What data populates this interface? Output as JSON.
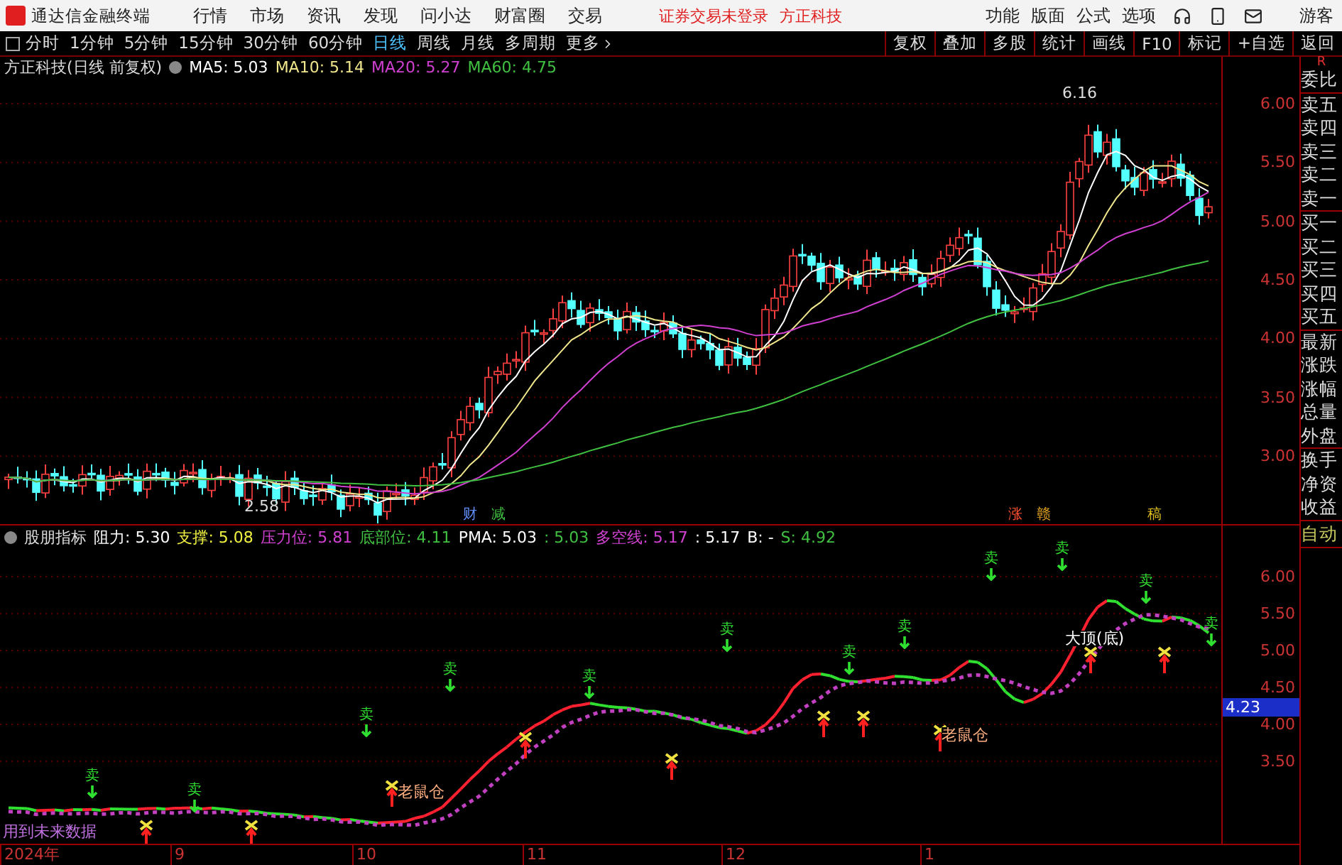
{
  "app_bar": {
    "title": "通达信金融终端",
    "menu": [
      "行情",
      "市场",
      "资讯",
      "发现",
      "问小达",
      "财富圈",
      "交易"
    ],
    "notice": "证券交易未登录",
    "stock": "方正科技",
    "right_menu": [
      "功能",
      "版面",
      "公式",
      "选项"
    ],
    "user": "游客"
  },
  "period_tabs": [
    {
      "label": "分时",
      "selected": false
    },
    {
      "label": "1分钟",
      "selected": false
    },
    {
      "label": "5分钟",
      "selected": false
    },
    {
      "label": "15分钟",
      "selected": false
    },
    {
      "label": "30分钟",
      "selected": false
    },
    {
      "label": "60分钟",
      "selected": false
    },
    {
      "label": "日线",
      "selected": true
    },
    {
      "label": "周线",
      "selected": false
    },
    {
      "label": "月线",
      "selected": false
    },
    {
      "label": "多周期",
      "selected": false
    },
    {
      "label": "更多",
      "selected": false
    }
  ],
  "tools": [
    "复权",
    "叠加",
    "多股",
    "统计",
    "画线",
    "F10",
    "标记",
    "+自选",
    "返回"
  ],
  "main_chart": {
    "title": "方正科技(日线 前复权)",
    "ma": [
      {
        "label": "MA5: 5.03",
        "color": "#ffffff"
      },
      {
        "label": "MA10: 5.14",
        "color": "#f0e68c"
      },
      {
        "label": "MA20: 5.27",
        "color": "#d040d0"
      },
      {
        "label": "MA60: 4.75",
        "color": "#40c040"
      }
    ],
    "high_label": "6.16",
    "low_label": "2.58",
    "events": [
      {
        "text": "财",
        "color": "#6090ff"
      },
      {
        "text": "减",
        "color": "#40c040"
      },
      {
        "text": "涨",
        "color": "#ff5030"
      },
      {
        "text": "赣",
        "color": "#e0a020"
      },
      {
        "text": "稿",
        "color": "#e0c020"
      }
    ],
    "y_axis": [
      "6.00",
      "5.50",
      "5.00",
      "4.50",
      "4.00",
      "3.50",
      "3.00"
    ]
  },
  "indicator": {
    "name": "股朋指标",
    "values": [
      {
        "text": "阻力: 5.30",
        "color": "#ffffff"
      },
      {
        "text": "支撑: 5.08",
        "color": "#f0f040"
      },
      {
        "text": "压力位: 5.81",
        "color": "#d040d0"
      },
      {
        "text": "底部位: 4.11",
        "color": "#40c040"
      },
      {
        "text": "PMA: 5.03",
        "color": "#ffffff"
      },
      {
        "text": ": 5.03",
        "color": "#40c040"
      },
      {
        "text": "多空线: 5.17",
        "color": "#d040d0"
      },
      {
        "text": ": 5.17",
        "color": "#ffffff"
      },
      {
        "text": "B: -",
        "color": "#ffffff"
      },
      {
        "text": "S: 4.92",
        "color": "#40c040"
      }
    ],
    "sell_markers": [
      "卖",
      "卖",
      "卖",
      "卖",
      "卖",
      "卖",
      "卖",
      "卖",
      "卖",
      "卖",
      "卖",
      "卖"
    ],
    "tags": [
      "老鼠仓",
      "老鼠仓",
      "大顶(底)"
    ],
    "warning": "用到未来数据",
    "y_axis": [
      "6.00",
      "5.50",
      "5.00",
      "4.50",
      "4.00",
      "3.50"
    ],
    "current": "4.23"
  },
  "x_axis": [
    "2024年",
    "9",
    "10",
    "11",
    "12",
    "1"
  ],
  "quote_panel": {
    "top": "R",
    "groups": [
      [
        "委比"
      ],
      [
        "卖五",
        "卖四",
        "卖三",
        "卖二",
        "卖一"
      ],
      [
        "买一",
        "买二",
        "买三",
        "买四",
        "买五"
      ],
      [
        "最新",
        "涨跌",
        "涨幅",
        "总量",
        "外盘"
      ],
      [
        "换手",
        "净资",
        "收益"
      ]
    ],
    "auto": "自动"
  }
}
